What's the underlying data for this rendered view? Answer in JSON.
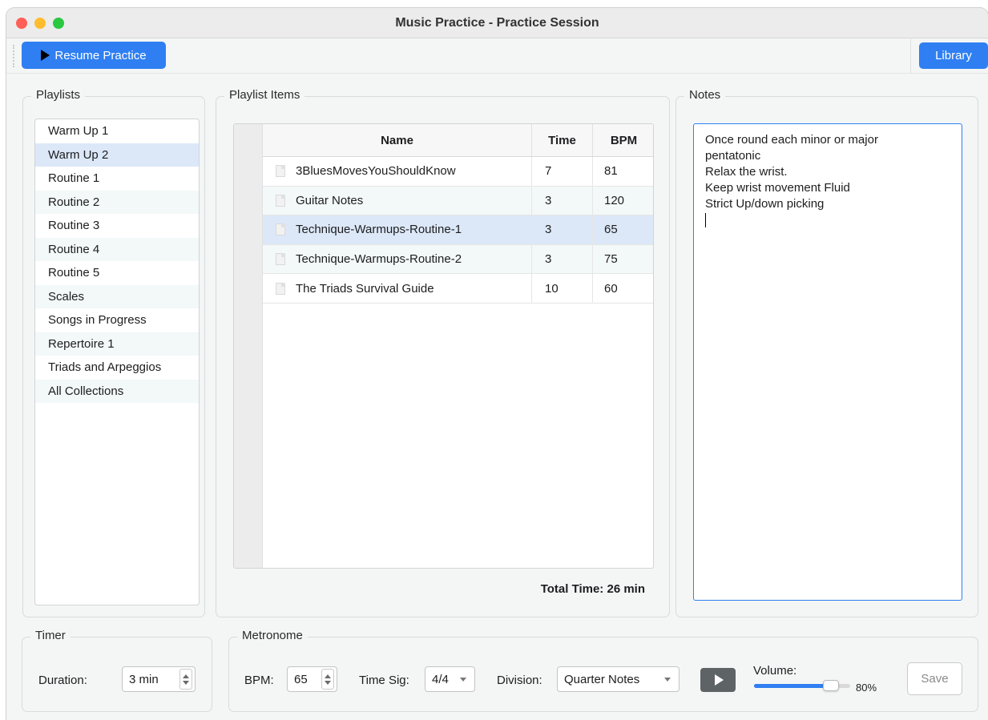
{
  "window": {
    "title": "Music Practice - Practice Session"
  },
  "toolbar": {
    "resume_label": "Resume Practice",
    "library_label": "Library"
  },
  "playlists": {
    "legend": "Playlists",
    "items": [
      {
        "label": "Warm Up 1"
      },
      {
        "label": "Warm Up 2",
        "selected": true
      },
      {
        "label": "Routine 1"
      },
      {
        "label": "Routine 2"
      },
      {
        "label": "Routine 3"
      },
      {
        "label": "Routine 4"
      },
      {
        "label": "Routine 5"
      },
      {
        "label": "Scales"
      },
      {
        "label": "Songs in Progress"
      },
      {
        "label": "Repertoire 1"
      },
      {
        "label": "Triads and Arpeggios"
      },
      {
        "label": "All Collections"
      }
    ]
  },
  "playlist_items": {
    "legend": "Playlist Items",
    "columns": {
      "name": "Name",
      "time": "Time",
      "bpm": "BPM"
    },
    "rows": [
      {
        "name": "3BluesMovesYouShouldKnow",
        "time": "7",
        "bpm": "81"
      },
      {
        "name": "Guitar Notes",
        "time": "3",
        "bpm": "120"
      },
      {
        "name": "Technique-Warmups-Routine-1",
        "time": "3",
        "bpm": "65",
        "selected": true
      },
      {
        "name": "Technique-Warmups-Routine-2",
        "time": "3",
        "bpm": "75"
      },
      {
        "name": "The Triads Survival Guide",
        "time": "10",
        "bpm": "60"
      }
    ],
    "total": "Total Time: 26 min"
  },
  "notes": {
    "legend": "Notes",
    "text": "Once round each minor or major\npentatonic\nRelax the wrist.\nKeep wrist movement Fluid\nStrict Up/down picking\n"
  },
  "timer": {
    "legend": "Timer",
    "duration_label": "Duration:",
    "duration_value": "3 min"
  },
  "metronome": {
    "legend": "Metronome",
    "bpm_label": "BPM:",
    "bpm_value": "65",
    "timesig_label": "Time Sig:",
    "timesig_value": "4/4",
    "division_label": "Division:",
    "division_value": "Quarter Notes",
    "volume_label": "Volume:",
    "volume_value": "80%",
    "volume_fraction": 0.8,
    "save_label": "Save"
  },
  "colors": {
    "accent": "#2f7ff2",
    "selection": "#dce8f8",
    "alt_row": "#f3f8f8"
  }
}
